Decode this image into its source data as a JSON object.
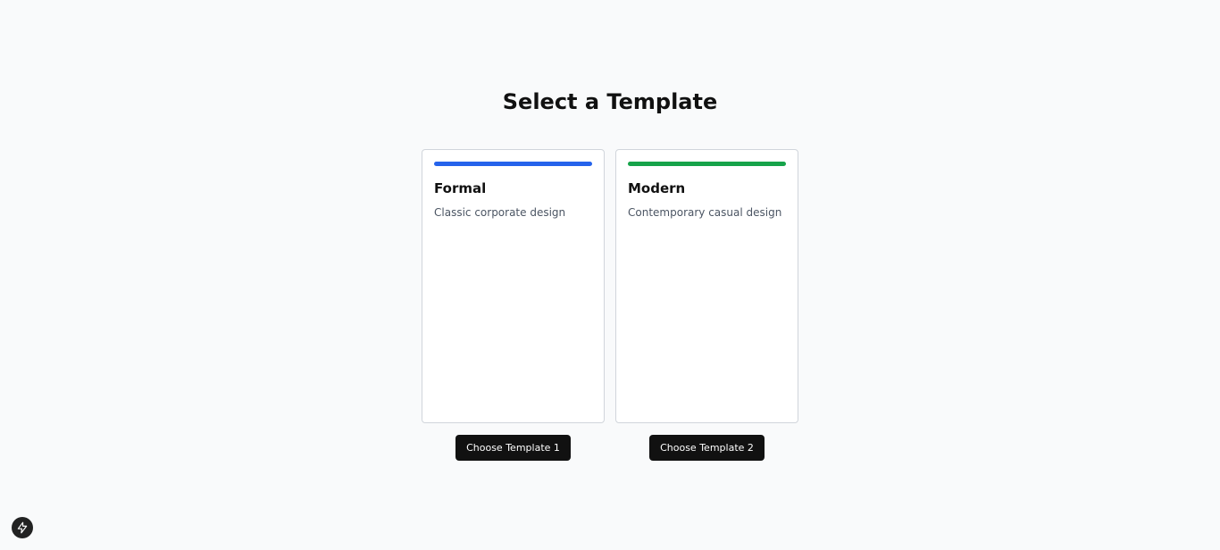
{
  "page": {
    "title": "Select a Template"
  },
  "templates": [
    {
      "name": "Formal",
      "description": "Classic corporate design",
      "accent_color": "#2563eb",
      "button_label": "Choose Template 1"
    },
    {
      "name": "Modern",
      "description": "Contemporary casual design",
      "accent_color": "#16a34a",
      "button_label": "Choose Template 2"
    }
  ],
  "floating_button": {
    "icon": "lightning-bolt-icon"
  }
}
